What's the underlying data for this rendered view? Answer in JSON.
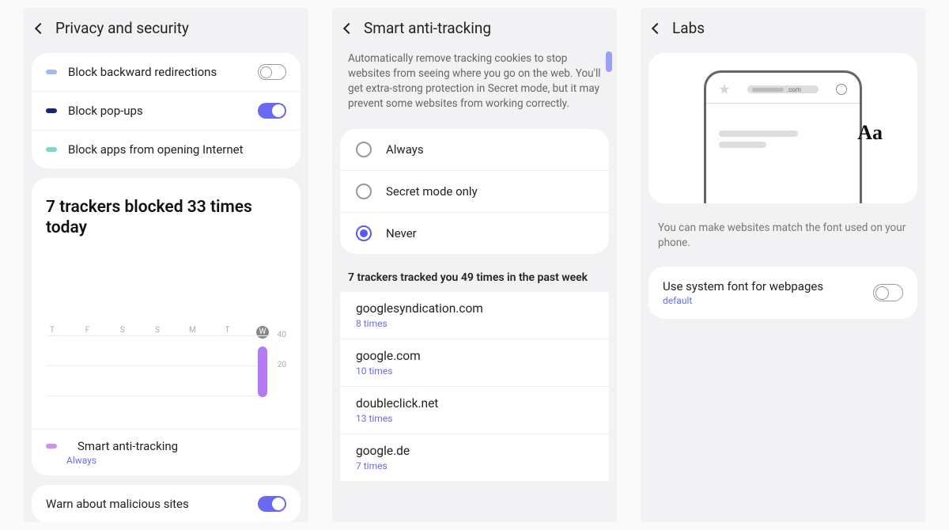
{
  "panel1": {
    "title": "Privacy and security",
    "rows": [
      {
        "label": "Block backward redirections",
        "bullet": "#a7b8e8",
        "toggle": "off"
      },
      {
        "label": "Block pop-ups",
        "bullet": "#1a237e",
        "toggle": "on"
      },
      {
        "label": "Block apps from opening Internet",
        "bullet": "#7fd8c8",
        "toggle": null
      }
    ],
    "stats_title": "7 trackers blocked 33 times today",
    "chart_y_ticks": [
      "40",
      "20"
    ],
    "smart_label": "Smart anti-tracking",
    "smart_value": "Always",
    "warn_label": "Warn about malicious sites"
  },
  "panel2": {
    "title": "Smart anti-tracking",
    "description": "Automatically remove tracking cookies to stop websites from seeing where you go on the web. You'll get extra-strong protection in Secret mode, but it may prevent some websites from working correctly.",
    "options": [
      {
        "label": "Always",
        "checked": false
      },
      {
        "label": "Secret mode only",
        "checked": false
      },
      {
        "label": "Never",
        "checked": true
      }
    ],
    "week_header": "7 trackers tracked you 49 times in the past week",
    "trackers": [
      {
        "domain": "googlesyndication.com",
        "count": "8 times"
      },
      {
        "domain": "google.com",
        "count": "10 times"
      },
      {
        "domain": "doubleclick.net",
        "count": "13 times"
      },
      {
        "domain": "google.de",
        "count": "7 times"
      }
    ]
  },
  "panel3": {
    "title": "Labs",
    "url_suffix": ".com",
    "aa_glyph": "Aa",
    "desc": "You can make websites match the font used on your phone.",
    "toggle_label": "Use system font for webpages",
    "toggle_sub": "default"
  },
  "chart_data": {
    "type": "bar",
    "categories": [
      "T",
      "F",
      "S",
      "S",
      "M",
      "T",
      "W"
    ],
    "values": [
      0,
      0,
      0,
      0,
      0,
      0,
      33
    ],
    "ylim": [
      0,
      40
    ],
    "ylabel": "",
    "xlabel": "",
    "title": "7 trackers blocked 33 times today",
    "highlight_index": 6
  }
}
